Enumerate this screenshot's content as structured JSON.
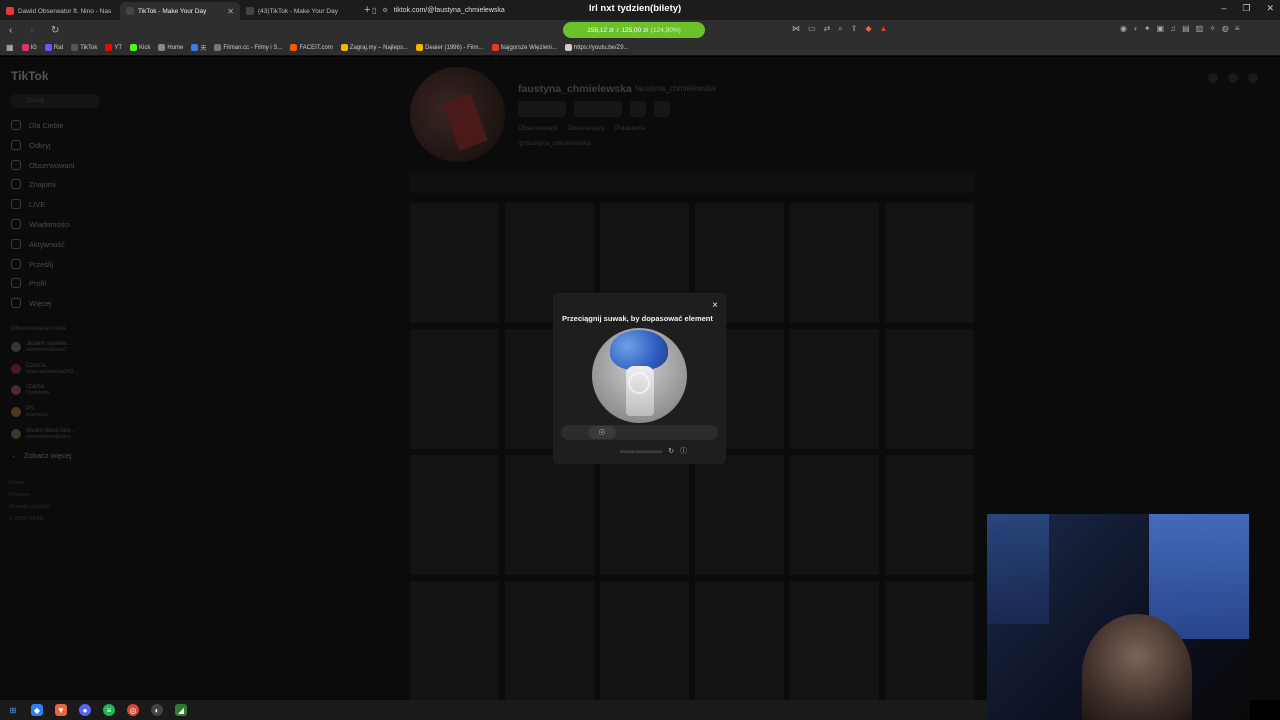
{
  "browser": {
    "tabs": [
      {
        "label": "Dawid Obserwator ft. Nino - Nas",
        "color": "#e53935",
        "active": false
      },
      {
        "label": "TikTok - Make Your Day",
        "color": "#ffffff",
        "active": true
      },
      {
        "label": "(43)TikTok - Make Your Day",
        "color": "#ffffff",
        "active": false
      }
    ],
    "new_tab": "+",
    "banner": "lrl nxt tydzien(bilety)",
    "url": "tiktok.com/@faustyna_chmielewska",
    "progress": {
      "amount": "156,12 zł",
      "sep": "/",
      "target": "125,00 zł",
      "pct": "(124,90%)",
      "fraction": 1.0,
      "color": "#6cc22a"
    },
    "bookmarks": [
      {
        "label": "IG",
        "color": "#e1306c"
      },
      {
        "label": "Rat",
        "color": "#7c4dff"
      },
      {
        "label": "TikTok",
        "color": "#ffffff"
      },
      {
        "label": "YT",
        "color": "#ff0000"
      },
      {
        "label": "Kick",
        "color": "#53fc18"
      },
      {
        "label": "Home",
        "color": "#ffffff"
      },
      {
        "label": "天",
        "color": "#2f80ed"
      },
      {
        "label": "Filman.cc - Filmy i S...",
        "color": "#ffffff"
      },
      {
        "label": "FACEIT.com",
        "color": "#ff5500"
      },
      {
        "label": "Zagraj.my – Najleps...",
        "color": "#f4b400"
      },
      {
        "label": "Dealer (1996) - Film...",
        "color": "#f4b400"
      },
      {
        "label": "Najgorsze Więzieni...",
        "color": "#e53935"
      },
      {
        "label": "https://youtu.be/Z9...",
        "color": "#cccccc"
      }
    ]
  },
  "tiktok": {
    "logo": "TikTok",
    "search_placeholder": "Szukaj",
    "nav": [
      {
        "label": "Dla Ciebie"
      },
      {
        "label": "Odkryj"
      },
      {
        "label": "Obserwowani"
      },
      {
        "label": "Znajomi"
      },
      {
        "label": "LIVE"
      },
      {
        "label": "Wiadomości"
      },
      {
        "label": "Aktywność"
      },
      {
        "label": "Prześlij"
      },
      {
        "label": "Profil"
      },
      {
        "label": "Więcej"
      }
    ],
    "followed_title": "Obserwowane konta",
    "followed": [
      {
        "name": "Jestem sowww...",
        "handle": "usertmsh0kxwz7"
      },
      {
        "name": "Czarna...",
        "handle": "czarnawiedzma343..."
      },
      {
        "name": "czarna",
        "handle": "f2wioletta"
      },
      {
        "name": "PS",
        "handle": "pszpszsz"
      },
      {
        "name": "Alvaro disco tani...",
        "handle": "mmsoinestatyczny"
      }
    ],
    "see_more": "Zobacz więcej",
    "footer": [
      "Firma",
      "Program",
      "Warunki i polityki",
      "© 2025 TikTok"
    ],
    "profile": {
      "username": "faustyna_chmielewska",
      "nickname": "faustyna_chmielewska",
      "stats": [
        "Obserwowani",
        "Obserwujący",
        "Polubienia"
      ],
      "bio": "ig:faustyna_chmielewska"
    }
  },
  "captcha": {
    "title": "Przeciągnij suwak, by dopasować element",
    "close": "×",
    "knob_icon": "fingerprint-icon",
    "footer_code": "2025082300000000000",
    "refresh_icon": "refresh-icon",
    "info_icon": "info-icon"
  }
}
